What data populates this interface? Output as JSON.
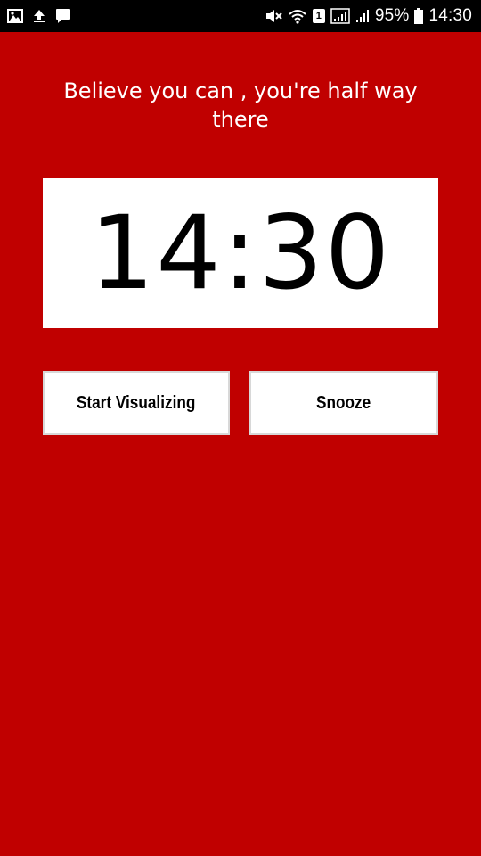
{
  "status_bar": {
    "battery_percent": "95%",
    "time": "14:30",
    "sim_slot": "1",
    "icons_left": [
      "image-icon",
      "upload-icon",
      "message-icon"
    ],
    "icons_right": [
      "mute-icon",
      "wifi-icon",
      "sim-badge",
      "signal-icon",
      "signal-icon",
      "battery-icon"
    ]
  },
  "quote": {
    "text": "Believe you can , you're half way there"
  },
  "clock": {
    "time": "14:30"
  },
  "buttons": {
    "start_visualizing": "Start Visualizing",
    "snooze": "Snooze"
  },
  "colors": {
    "background": "#c00000",
    "status_bar": "#000000",
    "card": "#ffffff"
  }
}
